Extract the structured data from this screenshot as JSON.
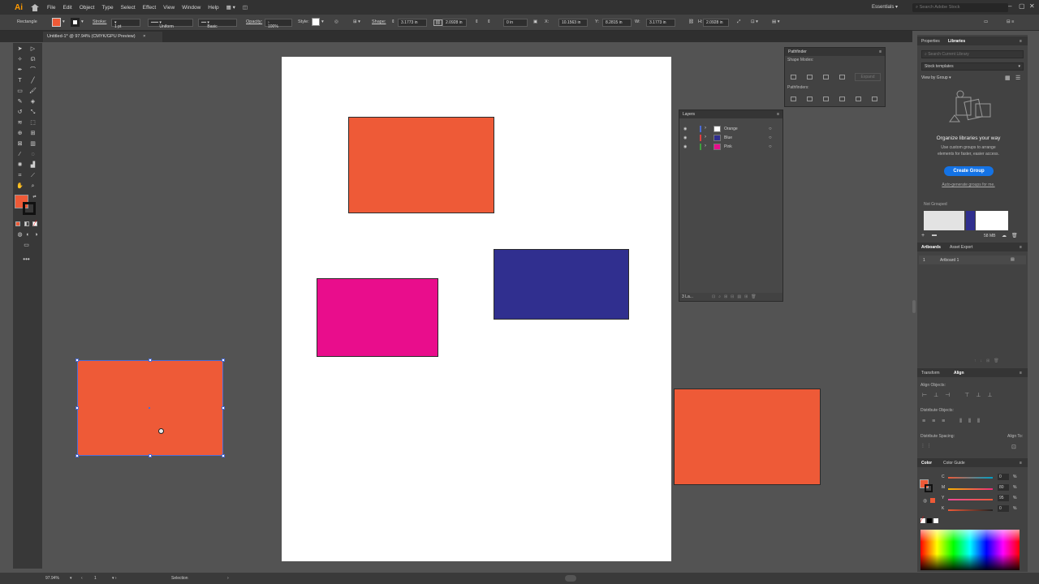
{
  "app": {
    "logo": "Ai",
    "workspace": "Essentials",
    "stock_search_placeholder": "Search Adobe Stock"
  },
  "menu": [
    "File",
    "Edit",
    "Object",
    "Type",
    "Select",
    "Effect",
    "View",
    "Window",
    "Help"
  ],
  "control_bar": {
    "object_type": "Rectangle",
    "stroke_label": "Stroke:",
    "stroke_weight": "1 pt",
    "stroke_profile": "Uniform",
    "brush": "Basic",
    "opacity_label": "Opacity:",
    "opacity": "100%",
    "style_label": "Style:",
    "shape_label": "Shape:",
    "shape_w": "3.1773 in",
    "shape_h": "2.0928 in",
    "angle": "0 in",
    "x": "10.1563 in",
    "y": "8.2815 in",
    "w": "3.1773 in",
    "h": "2.0928 in"
  },
  "document_tab": {
    "title": "Untitled-1* @ 97.94% (CMYK/GPU Preview)",
    "close": "×"
  },
  "colors": {
    "orange": "#ee5a37",
    "blue": "#302f8f",
    "pink": "#e90d8c",
    "accent": "#1473e6"
  },
  "pathfinder": {
    "title": "Pathfinder",
    "shape_modes_label": "Shape Modes:",
    "pathfinders_label": "Pathfinders:",
    "expand_label": "Expand"
  },
  "layers": {
    "title": "Layers",
    "items": [
      {
        "name": "Orange",
        "color": "#4b6cd6"
      },
      {
        "name": "Blue",
        "color": "#e04040"
      },
      {
        "name": "Pink",
        "color": "#3fa03f"
      }
    ],
    "footer_count": "3 La..."
  },
  "libraries": {
    "tabs": [
      "Properties",
      "Libraries"
    ],
    "search_placeholder": "Search Current Library",
    "library_name": "Stock templates",
    "view_by": "View by Group",
    "promo_title": "Organize libraries your way",
    "promo_text_1": "Use custom groups to arrange",
    "promo_text_2": "elements for faster, easier access.",
    "create_group": "Create Group",
    "auto_link": "Auto-generate groups for me.",
    "not_grouped": "Not Grouped",
    "size": "58 MB"
  },
  "artboards_panel": {
    "tabs": [
      "Artboards",
      "Asset Export"
    ],
    "rows": [
      {
        "index": "1",
        "name": "Artboard 1"
      }
    ]
  },
  "align_panel": {
    "tabs": [
      "Transform",
      "Align"
    ],
    "align_objects": "Align Objects:",
    "distribute_objects": "Distribute Objects:",
    "distribute_spacing": "Distribute Spacing:",
    "align_to": "Align To:"
  },
  "color_panel": {
    "tabs": [
      "Color",
      "Color Guide"
    ],
    "channels": [
      {
        "label": "C",
        "value": "0",
        "pct": "%"
      },
      {
        "label": "M",
        "value": "80",
        "pct": "%"
      },
      {
        "label": "Y",
        "value": "95",
        "pct": "%"
      },
      {
        "label": "K",
        "value": "0",
        "pct": "%"
      }
    ]
  },
  "status_bar": {
    "zoom": "97.94%",
    "artboard_num": "1",
    "tool": "Selection"
  }
}
